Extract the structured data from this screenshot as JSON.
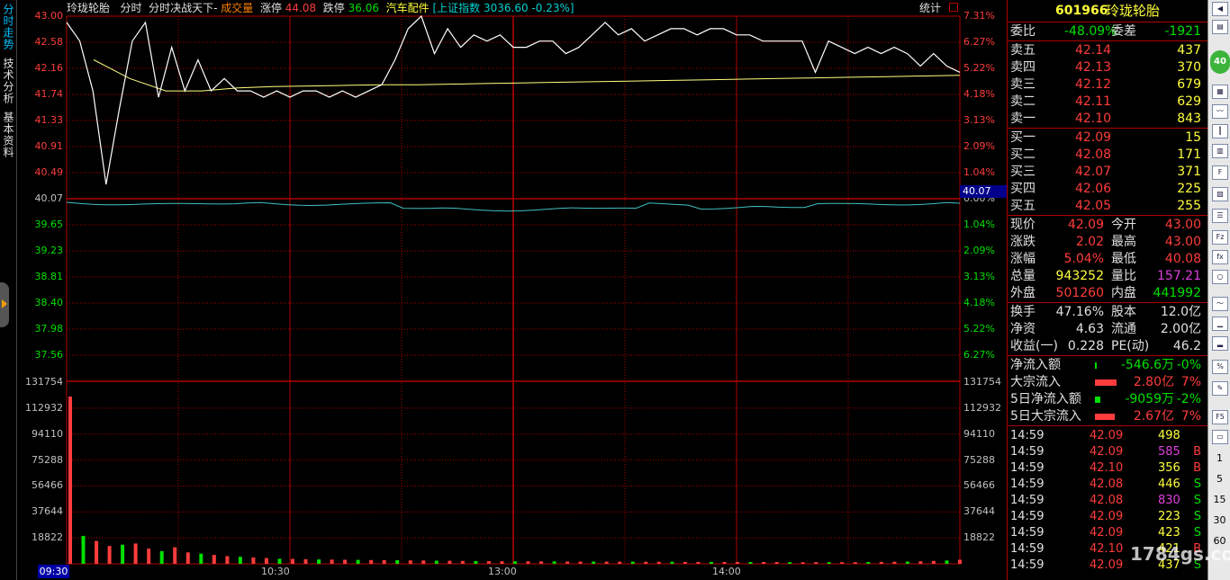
{
  "left_tabs": [
    "分时走势",
    "技术分析",
    "基本资料"
  ],
  "header": {
    "stock_name": "玲珑轮胎",
    "mode": "分时",
    "title_suffix": "分时决战天下-",
    "volume_label": "成交量",
    "limit_up_label": "涨停",
    "limit_up_value": "44.08",
    "limit_down_label": "跌停",
    "limit_down_value": "36.06",
    "sector": "汽车配件",
    "index_label": "[上证指数 3036.60 -0.23%]",
    "stats_label": "统计"
  },
  "price_axis_left": [
    "43.00",
    "42.58",
    "42.16",
    "41.74",
    "41.33",
    "40.91",
    "40.49",
    "40.07",
    "39.65",
    "39.23",
    "38.81",
    "38.40",
    "37.98",
    "37.56"
  ],
  "price_axis_right": [
    "7.31%",
    "6.27%",
    "5.22%",
    "4.18%",
    "3.13%",
    "2.09%",
    "1.04%",
    "0.00%",
    "1.04%",
    "2.09%",
    "3.13%",
    "4.18%",
    "5.22%",
    "6.27%"
  ],
  "volume_axis": [
    "131754",
    "112932",
    "94110",
    "75288",
    "56466",
    "37644",
    "18822"
  ],
  "time_axis": [
    "09:30",
    "10:30",
    "13:00",
    "14:00"
  ],
  "current_price_box": "40.07",
  "chart_data": {
    "type": "line",
    "price_series_name": "",
    "ylim": [
      37.56,
      43.0
    ],
    "prev_close": 40.07,
    "price": [
      42.9,
      42.6,
      41.8,
      40.3,
      41.5,
      42.6,
      42.9,
      41.7,
      42.5,
      41.8,
      42.3,
      41.8,
      42.0,
      41.8,
      41.8,
      41.7,
      41.8,
      41.7,
      41.8,
      41.8,
      41.7,
      41.8,
      41.7,
      41.8,
      41.9,
      42.3,
      42.8,
      43.0,
      42.4,
      42.8,
      42.5,
      42.7,
      42.6,
      42.7,
      42.5,
      42.5,
      42.6,
      42.6,
      42.4,
      42.5,
      42.7,
      42.9,
      42.7,
      42.8,
      42.6,
      42.7,
      42.8,
      42.8,
      42.7,
      42.8,
      42.8,
      42.7,
      42.7,
      42.6,
      42.6,
      42.6,
      42.6,
      42.1,
      42.6,
      42.5,
      42.4,
      42.5,
      42.4,
      42.5,
      42.4,
      42.2,
      42.4,
      42.2,
      42.1
    ],
    "avg_price": [
      42.3,
      42.0,
      41.8,
      41.8,
      41.85,
      41.87,
      41.88,
      41.89,
      41.9,
      41.9,
      41.91,
      41.92,
      41.93,
      41.94,
      41.95,
      41.96,
      41.97,
      41.98,
      41.99,
      42.0,
      42.01,
      42.02,
      42.03,
      42.04,
      42.05
    ],
    "volume": [
      131754,
      22000,
      18000,
      14000,
      15000,
      16000,
      12000,
      10000,
      13000,
      9000,
      8000,
      7000,
      6000,
      5500,
      5000,
      4500,
      4000,
      3800,
      3600,
      3500,
      3300,
      3200,
      3100,
      3000,
      2900,
      2800,
      2700,
      2600,
      2500,
      2400,
      2300,
      2200,
      2100,
      2000,
      2000,
      2000,
      1900,
      1900,
      1800,
      1800,
      1800,
      1700,
      1700,
      1700,
      1600,
      1600,
      1600,
      1500,
      1500,
      1500,
      1500,
      1400,
      1400,
      1400,
      1400,
      1300,
      1300,
      1300,
      1300,
      1300,
      1300,
      1400,
      1500,
      1600,
      1800,
      2000,
      2300,
      2600,
      3200
    ]
  },
  "right_panel": {
    "code": "601966",
    "name": "玲珑轮胎",
    "weibi_label": "委比",
    "weibi_value": "-48.09%",
    "weicha_label": "委差",
    "weicha_value": "-1921",
    "asks": [
      {
        "label": "卖五",
        "price": "42.14",
        "vol": "437"
      },
      {
        "label": "卖四",
        "price": "42.13",
        "vol": "370"
      },
      {
        "label": "卖三",
        "price": "42.12",
        "vol": "679"
      },
      {
        "label": "卖二",
        "price": "42.11",
        "vol": "629"
      },
      {
        "label": "卖一",
        "price": "42.10",
        "vol": "843"
      }
    ],
    "bids": [
      {
        "label": "买一",
        "price": "42.09",
        "vol": "15"
      },
      {
        "label": "买二",
        "price": "42.08",
        "vol": "171"
      },
      {
        "label": "买三",
        "price": "42.07",
        "vol": "371"
      },
      {
        "label": "买四",
        "price": "42.06",
        "vol": "225"
      },
      {
        "label": "买五",
        "price": "42.05",
        "vol": "255"
      }
    ],
    "quote": [
      {
        "l1": "现价",
        "v1": "42.09",
        "l2": "今开",
        "v2": "43.00"
      },
      {
        "l1": "涨跌",
        "v1": "2.02",
        "l2": "最高",
        "v2": "43.00"
      },
      {
        "l1": "涨幅",
        "v1": "5.04%",
        "l2": "最低",
        "v2": "40.08"
      },
      {
        "l1": "总量",
        "v1": "943252",
        "l2": "量比",
        "v2": "157.21"
      },
      {
        "l1": "外盘",
        "v1": "501260",
        "l2": "内盘",
        "v2": "441992"
      }
    ],
    "fund": [
      {
        "l1": "换手",
        "v1": "47.16%",
        "l2": "股本",
        "v2": "12.0亿"
      },
      {
        "l1": "净资",
        "v1": "4.63",
        "l2": "流通",
        "v2": "2.00亿"
      },
      {
        "l1": "收益(一)",
        "v1": "0.228",
        "l2": "PE(动)",
        "v2": "46.2"
      }
    ],
    "flow": [
      {
        "label": "净流入额",
        "value": "-546.6万",
        "pct": "-0%"
      },
      {
        "label": "大宗流入",
        "value": "2.80亿",
        "pct": "7%"
      },
      {
        "label": "5日净流入额",
        "value": "-9059万",
        "pct": "-2%"
      },
      {
        "label": "5日大宗流入",
        "value": "2.67亿",
        "pct": "7%"
      }
    ],
    "ticks": [
      {
        "time": "14:59",
        "price": "42.09",
        "vol": "498",
        "side": ""
      },
      {
        "time": "14:59",
        "price": "42.09",
        "vol": "585",
        "side": "B"
      },
      {
        "time": "14:59",
        "price": "42.10",
        "vol": "356",
        "side": "B"
      },
      {
        "time": "14:59",
        "price": "42.08",
        "vol": "446",
        "side": "S"
      },
      {
        "time": "14:59",
        "price": "42.08",
        "vol": "830",
        "side": "S"
      },
      {
        "time": "14:59",
        "price": "42.09",
        "vol": "223",
        "side": "S"
      },
      {
        "time": "14:59",
        "price": "42.09",
        "vol": "423",
        "side": "S"
      },
      {
        "time": "14:59",
        "price": "42.10",
        "vol": "421",
        "side": "B"
      },
      {
        "time": "14:59",
        "price": "42.09",
        "vol": "437",
        "side": "S"
      }
    ]
  },
  "toolbar_numbers": [
    "1",
    "5",
    "15",
    "30",
    "60"
  ],
  "toolbar_f5": "F5",
  "watermark": "1784gs.com",
  "colors": {
    "up": "#ff3c3c",
    "down": "#00e000",
    "grid": "#b00000",
    "price_line": "#ffffff",
    "avg_line": "#ffff80",
    "lower_line": "#40c0c0"
  }
}
